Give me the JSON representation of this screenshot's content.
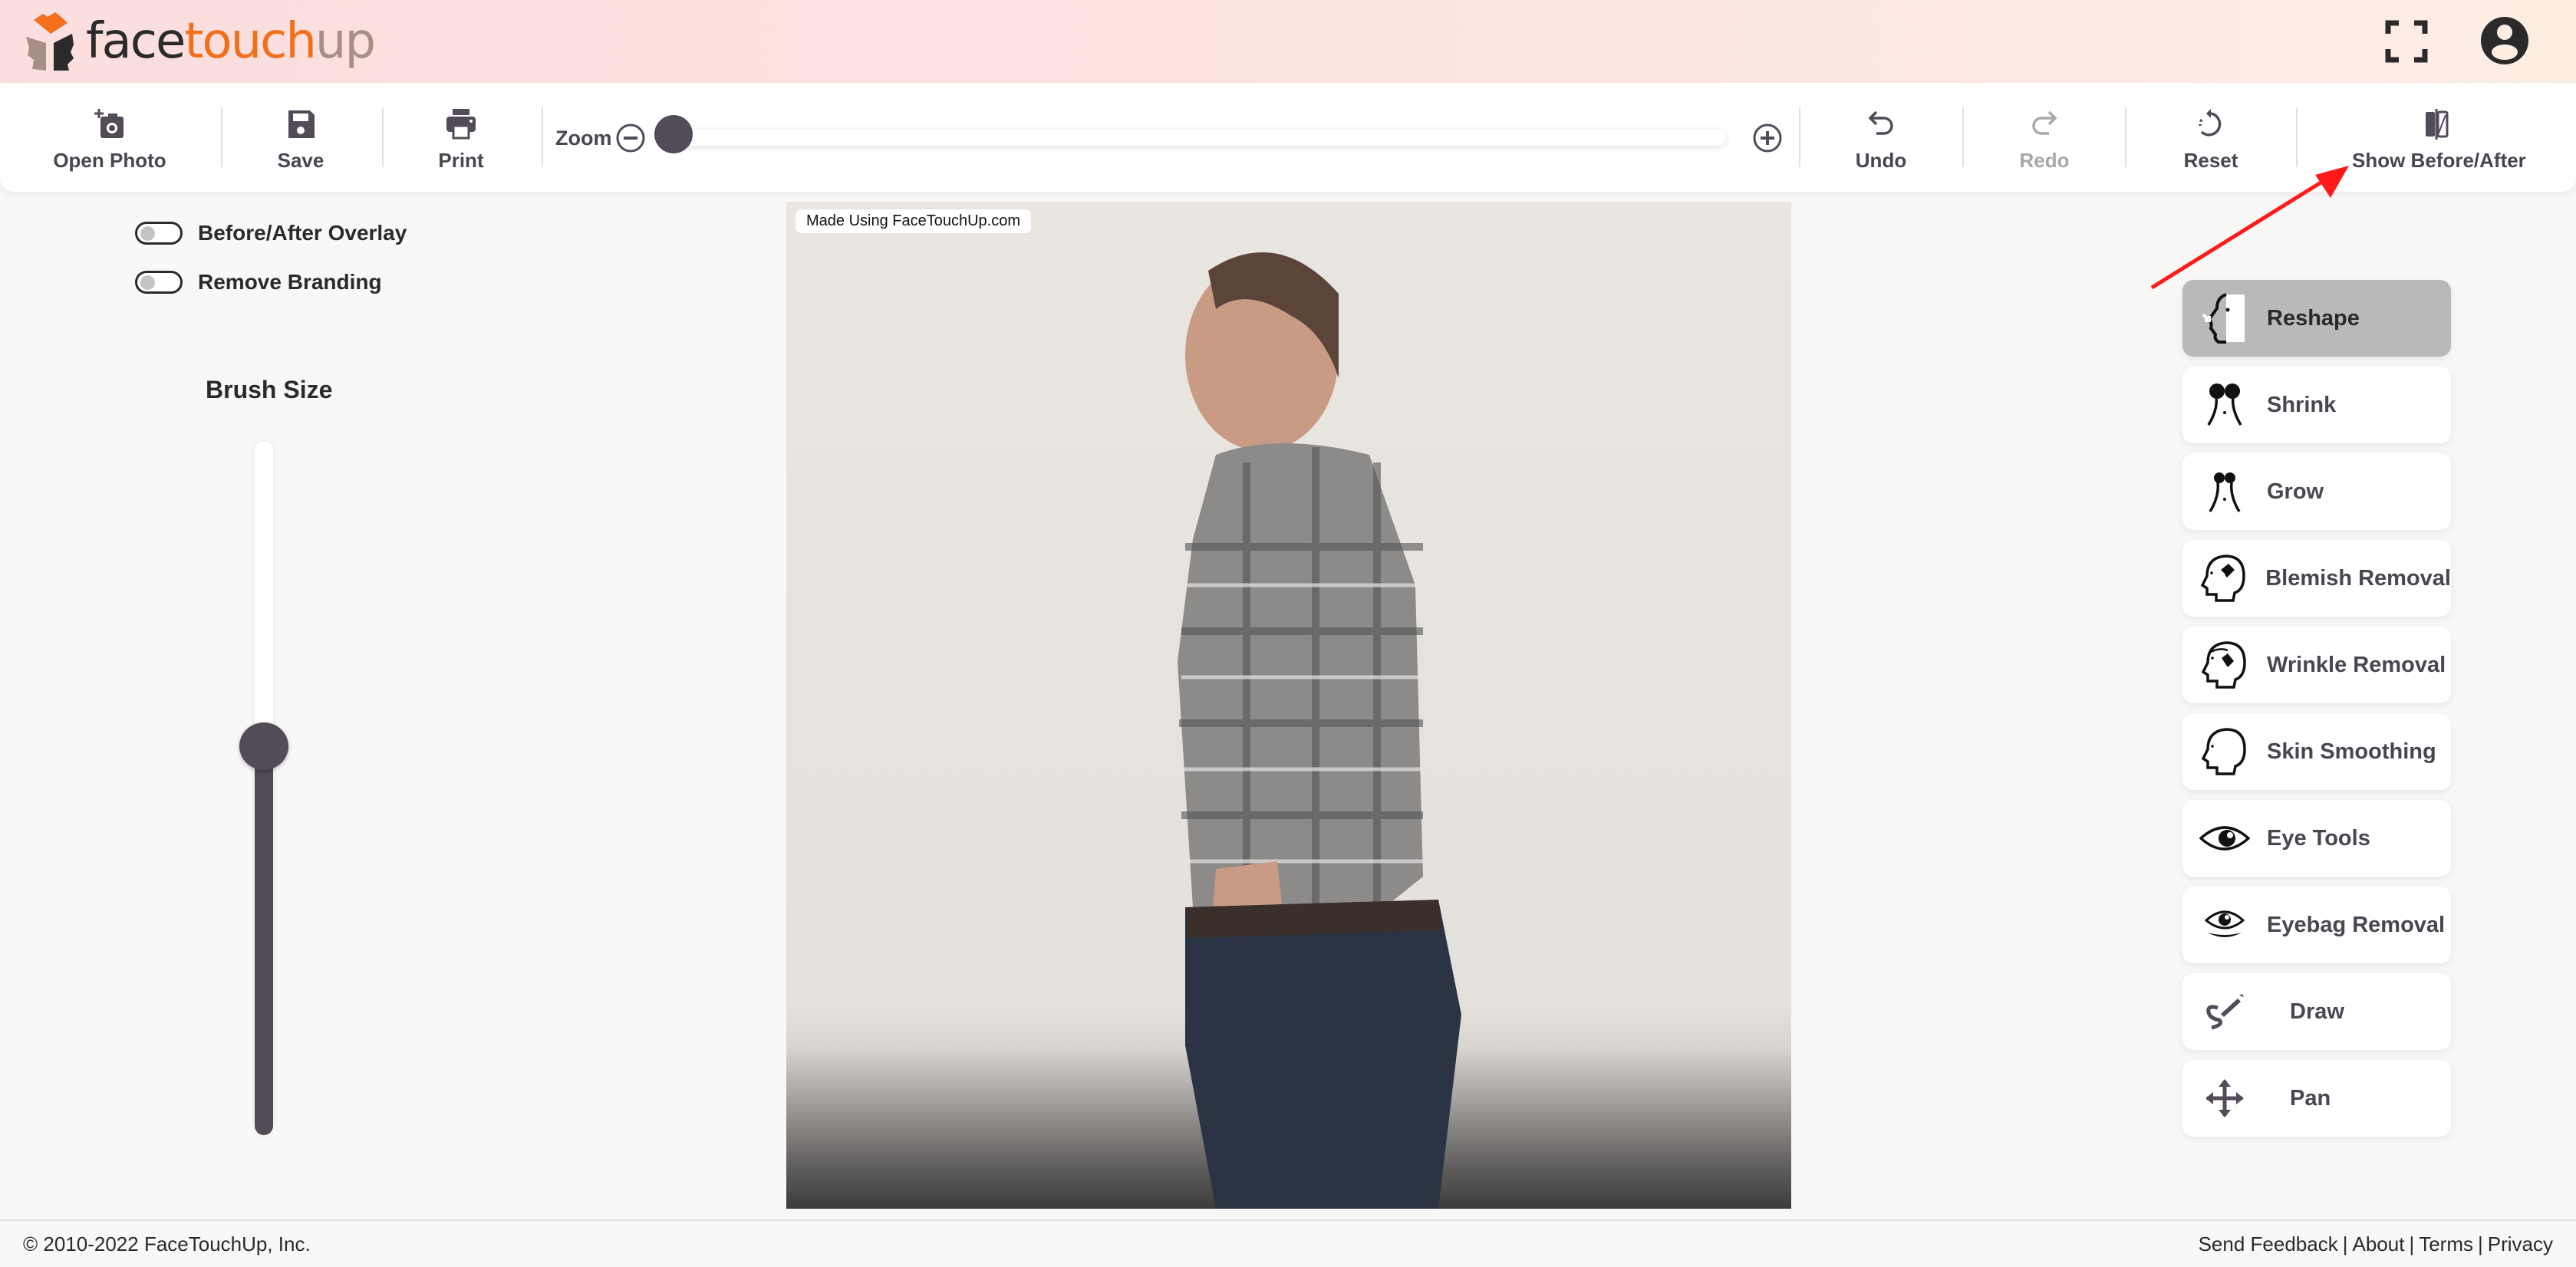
{
  "header": {
    "logo": {
      "part1": "face",
      "part2": "touch",
      "part3": "up",
      "icon": "facetouchup-logo-icon"
    },
    "fullscreen_icon": "fullscreen-icon",
    "account_icon": "account-circle-icon"
  },
  "toolbar": {
    "open_photo": {
      "label": "Open Photo",
      "icon": "add-photo-icon"
    },
    "save": {
      "label": "Save",
      "icon": "floppy-disk-icon"
    },
    "print": {
      "label": "Print",
      "icon": "printer-icon"
    },
    "zoom": {
      "label": "Zoom",
      "value_fraction": 0.0,
      "minus_icon": "zoom-out-icon",
      "plus_icon": "zoom-in-icon"
    },
    "undo": {
      "label": "Undo",
      "icon": "undo-icon",
      "enabled": true
    },
    "redo": {
      "label": "Redo",
      "icon": "redo-icon",
      "enabled": false
    },
    "reset": {
      "label": "Reset",
      "icon": "reset-icon"
    },
    "before_after": {
      "label": "Show Before/After",
      "icon": "compare-icon"
    }
  },
  "left_panel": {
    "toggles": [
      {
        "label": "Before/After Overlay",
        "on": false
      },
      {
        "label": "Remove Branding",
        "on": false
      }
    ],
    "brush_size": {
      "title": "Brush Size",
      "value_fraction": 0.56
    }
  },
  "canvas": {
    "watermark": "Made Using FaceTouchUp.com",
    "image_description": "Side profile photo of a man in a plaid short-sleeve shirt and jeans"
  },
  "tools": [
    {
      "label": "Reshape",
      "icon": "reshape-face-icon",
      "active": true
    },
    {
      "label": "Shrink",
      "icon": "shrink-body-icon",
      "active": false
    },
    {
      "label": "Grow",
      "icon": "grow-body-icon",
      "active": false
    },
    {
      "label": "Blemish Removal",
      "icon": "blemish-removal-icon",
      "active": false
    },
    {
      "label": "Wrinkle Removal",
      "icon": "wrinkle-removal-icon",
      "active": false
    },
    {
      "label": "Skin Smoothing",
      "icon": "skin-smoothing-icon",
      "active": false
    },
    {
      "label": "Eye Tools",
      "icon": "eye-icon",
      "active": false
    },
    {
      "label": "Eyebag Removal",
      "icon": "eyebag-icon",
      "active": false
    },
    {
      "label": "Draw",
      "icon": "draw-pen-icon",
      "active": false
    },
    {
      "label": "Pan",
      "icon": "pan-arrows-icon",
      "active": false
    }
  ],
  "annotation": {
    "arrow_color": "#ff1a1a",
    "target": "Show Before/After"
  },
  "footer": {
    "copyright": "© 2010-2022 FaceTouchUp, Inc.",
    "links": [
      "Send Feedback",
      "About",
      "Terms",
      "Privacy"
    ]
  },
  "colors": {
    "accent": "#f26f1c",
    "dark": "#524b58",
    "logo_gray": "#a69086"
  }
}
